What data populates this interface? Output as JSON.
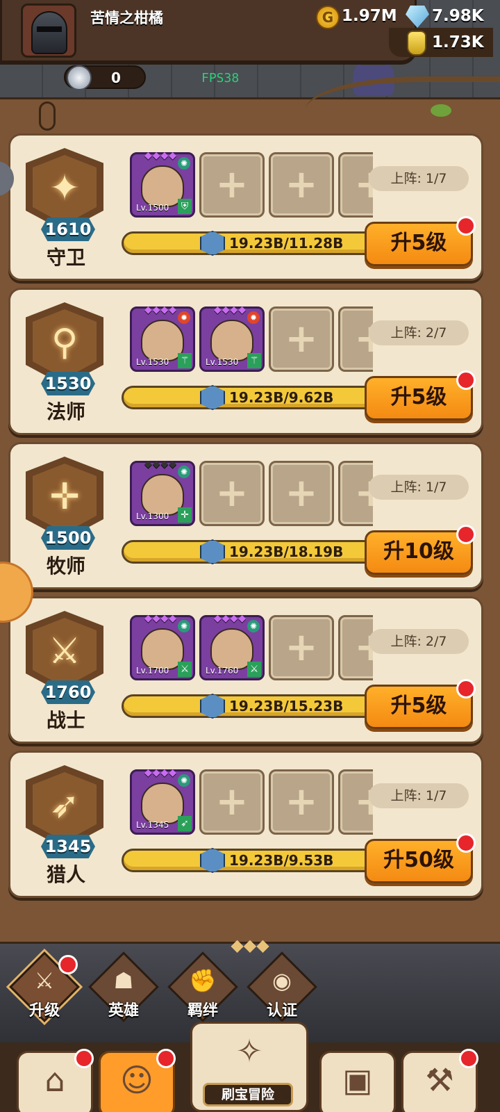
{
  "header": {
    "player_name": "苦情之柑橘",
    "gold": "1.97M",
    "diamonds": "7.98K",
    "potion": "1.73K",
    "silver": "0",
    "fps": "FPS38"
  },
  "cards": [
    {
      "class_name": "守卫",
      "power": "1610",
      "icon": "shield-star-icon",
      "on_field": "上阵: 1/7",
      "progress": "19.23B/11.28B",
      "button": "升5级",
      "heroes": [
        {
          "level": "Lv.1500",
          "stars": "◆◆◆◆",
          "stars_color": "#c86cf0",
          "element": "wind",
          "role": "shield"
        }
      ]
    },
    {
      "class_name": "法师",
      "power": "1530",
      "icon": "staff-icon",
      "on_field": "上阵: 2/7",
      "progress": "19.23B/9.62B",
      "button": "升5级",
      "heroes": [
        {
          "level": "Lv.1530",
          "stars": "◆◆◆◆",
          "stars_color": "#c86cf0",
          "element": "fire",
          "role": "wand"
        },
        {
          "level": "Lv.1530",
          "stars": "◆◆◆◆",
          "stars_color": "#c86cf0",
          "element": "fire",
          "role": "wand"
        }
      ]
    },
    {
      "class_name": "牧师",
      "power": "1500",
      "icon": "cross-icon",
      "on_field": "上阵: 1/7",
      "progress": "19.23B/18.19B",
      "button": "升10级",
      "heroes": [
        {
          "level": "Lv.1300",
          "stars": "◆◆◆◆",
          "stars_color": "#333333",
          "element": "wind",
          "role": "cross"
        }
      ]
    },
    {
      "class_name": "战士",
      "power": "1760",
      "icon": "sword-icon",
      "on_field": "上阵: 2/7",
      "progress": "19.23B/15.23B",
      "button": "升5级",
      "heroes": [
        {
          "level": "Lv.1700",
          "stars": "◆◆◆◆",
          "stars_color": "#c86cf0",
          "element": "wind",
          "role": "sword"
        },
        {
          "level": "Lv.1760",
          "stars": "◆◆◆◆",
          "stars_color": "#c86cf0",
          "element": "wind",
          "role": "sword"
        }
      ]
    },
    {
      "class_name": "猎人",
      "power": "1345",
      "icon": "bow-icon",
      "on_field": "上阵: 1/7",
      "progress": "19.23B/9.53B",
      "button": "升50级",
      "heroes": [
        {
          "level": "Lv.1345",
          "stars": "◆◆◆◆",
          "stars_color": "#c86cf0",
          "element": "wind",
          "role": "bow"
        }
      ]
    }
  ],
  "tabs": [
    {
      "label": "升级",
      "icon": "sword-icon",
      "active": true,
      "badge": true
    },
    {
      "label": "英雄",
      "icon": "hero-icon",
      "active": false,
      "badge": false
    },
    {
      "label": "羁绊",
      "icon": "fist-icon",
      "active": false,
      "badge": false
    },
    {
      "label": "认证",
      "icon": "eye-icon",
      "active": false,
      "badge": false
    }
  ],
  "bottom_nav": {
    "treasure_label": "刷宝冒险",
    "items": [
      {
        "icon": "shop-icon",
        "active": false,
        "badge": true
      },
      {
        "icon": "hero-portrait-icon",
        "active": true,
        "badge": true
      },
      {
        "icon": "map-compass-icon",
        "active": false,
        "badge": false
      },
      {
        "icon": "backpack-icon",
        "active": false,
        "badge": false
      },
      {
        "icon": "hammer-icon",
        "active": false,
        "badge": true
      }
    ]
  },
  "colors": {
    "accent_orange": "#f48a12",
    "badge_red": "#e6262b",
    "power_teal": "#2a6c88",
    "hero_purple": "#7b3fa0"
  }
}
